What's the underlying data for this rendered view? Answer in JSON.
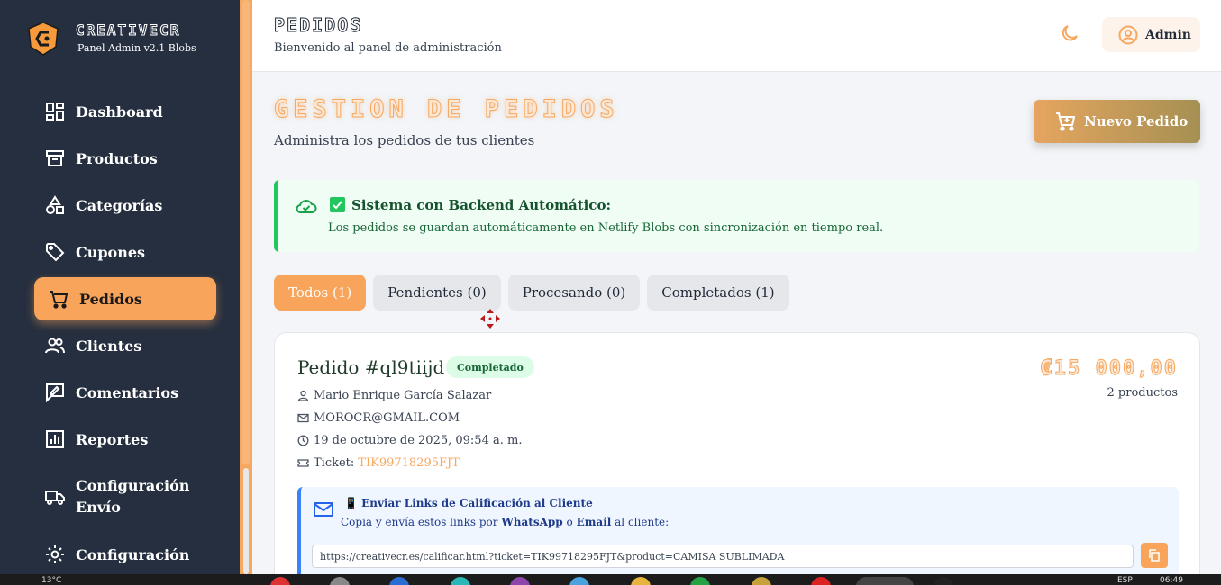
{
  "sidebar": {
    "brand_name": "CREATIVECR",
    "brand_subtitle": "Panel Admin v2.1 Blobs",
    "items": [
      {
        "label": "Dashboard",
        "icon": "dashboard-icon"
      },
      {
        "label": "Productos",
        "icon": "archive-icon"
      },
      {
        "label": "Categorías",
        "icon": "shapes-icon"
      },
      {
        "label": "Cupones",
        "icon": "tag-icon"
      },
      {
        "label": "Pedidos",
        "icon": "cart-icon",
        "active": true
      },
      {
        "label": "Clientes",
        "icon": "users-icon"
      },
      {
        "label": "Comentarios",
        "icon": "comment-edit-icon"
      },
      {
        "label": "Reportes",
        "icon": "bar-chart-icon"
      },
      {
        "label": "Configuración Envío",
        "icon": "truck-icon"
      },
      {
        "label": "Configuración",
        "icon": "gear-icon"
      }
    ]
  },
  "header": {
    "title": "PEDIDOS",
    "subtitle": "Bienvenido al panel de administración",
    "user_label": "Admin"
  },
  "main": {
    "title": "GESTION DE PEDIDOS",
    "subtitle": "Administra los pedidos de tus clientes",
    "new_order_label": "Nuevo Pedido"
  },
  "alert": {
    "title": "Sistema con Backend Automático:",
    "body": "Los pedidos se guardan automáticamente en Netlify Blobs con sincronización en tiempo real."
  },
  "tabs": [
    {
      "label": "Todos (1)",
      "active": true
    },
    {
      "label": "Pendientes (0)"
    },
    {
      "label": "Procesando (0)"
    },
    {
      "label": "Completados (1)"
    }
  ],
  "order": {
    "id": "Pedido #ql9tiijd",
    "status": "Completado",
    "amount": "₡15 000,00",
    "product_count": "2 productos",
    "customer": "Mario Enrique García Salazar",
    "email": "MOROCR@GMAIL.COM",
    "date": "19 de octubre de 2025, 09:54 a. m.",
    "ticket_label": "Ticket:",
    "ticket_code": "TIK99718295FJT"
  },
  "rating": {
    "title": "📱 Enviar Links de Calificación al Cliente",
    "desc_prefix": "Copia y envía estos links por",
    "desc_whatsapp": "WhatsApp",
    "desc_or": "o",
    "desc_email": "Email",
    "desc_suffix": "al cliente:",
    "link": "https://creativecr.es/calificar.html?ticket=TIK99718295FJT&product=CAMISA SUBLIMADA"
  },
  "taskbar": {
    "temperature": "13°C",
    "language": "ESP",
    "time": "06:49"
  },
  "colors": {
    "accent": "#f8a55b",
    "sidebar_bg": "#262f3f",
    "success": "#22c55e",
    "info": "#3b82f6"
  }
}
